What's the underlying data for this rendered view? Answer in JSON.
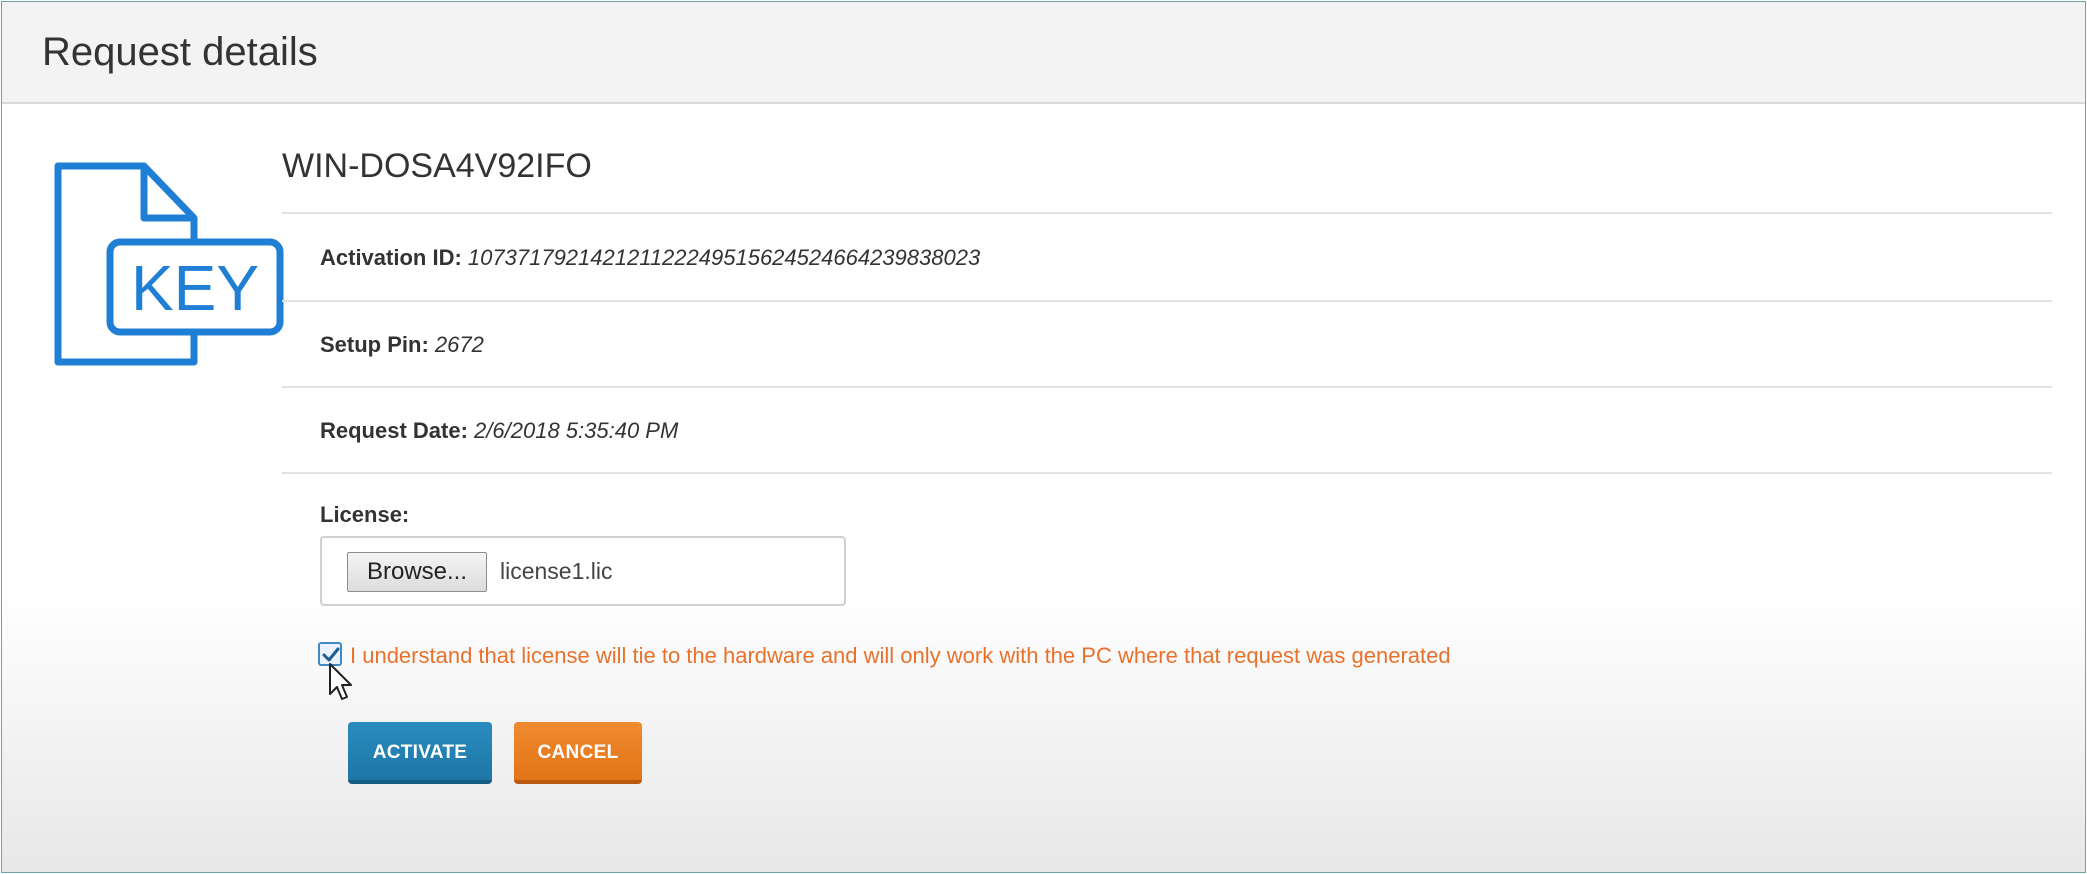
{
  "header": {
    "title": "Request details"
  },
  "request": {
    "icon": "key-file-icon",
    "icon_text": "KEY",
    "machine_name": "WIN-DOSA4V92IFO",
    "activation_id_label": "Activation ID:",
    "activation_id_value": "1073717921421211222495156245246642398380 23",
    "setup_pin_label": "Setup Pin:",
    "setup_pin_value": "2672",
    "request_date_label": "Request Date:",
    "request_date_value": "2/6/2018 5:35:40 PM"
  },
  "license": {
    "label": "License:",
    "browse_label": "Browse...",
    "file_name": "license1.lic"
  },
  "acknowledgement": {
    "checked": true,
    "text": "I understand that license will tie to the hardware and will only work with the PC where that request was generated"
  },
  "actions": {
    "activate_label": "ACTIVATE",
    "cancel_label": "CANCEL"
  },
  "colors": {
    "accent_blue": "#1f7fd4",
    "activate_button": "#1f80b2",
    "cancel_button": "#ea7c22",
    "warning_text": "#e8722c"
  }
}
